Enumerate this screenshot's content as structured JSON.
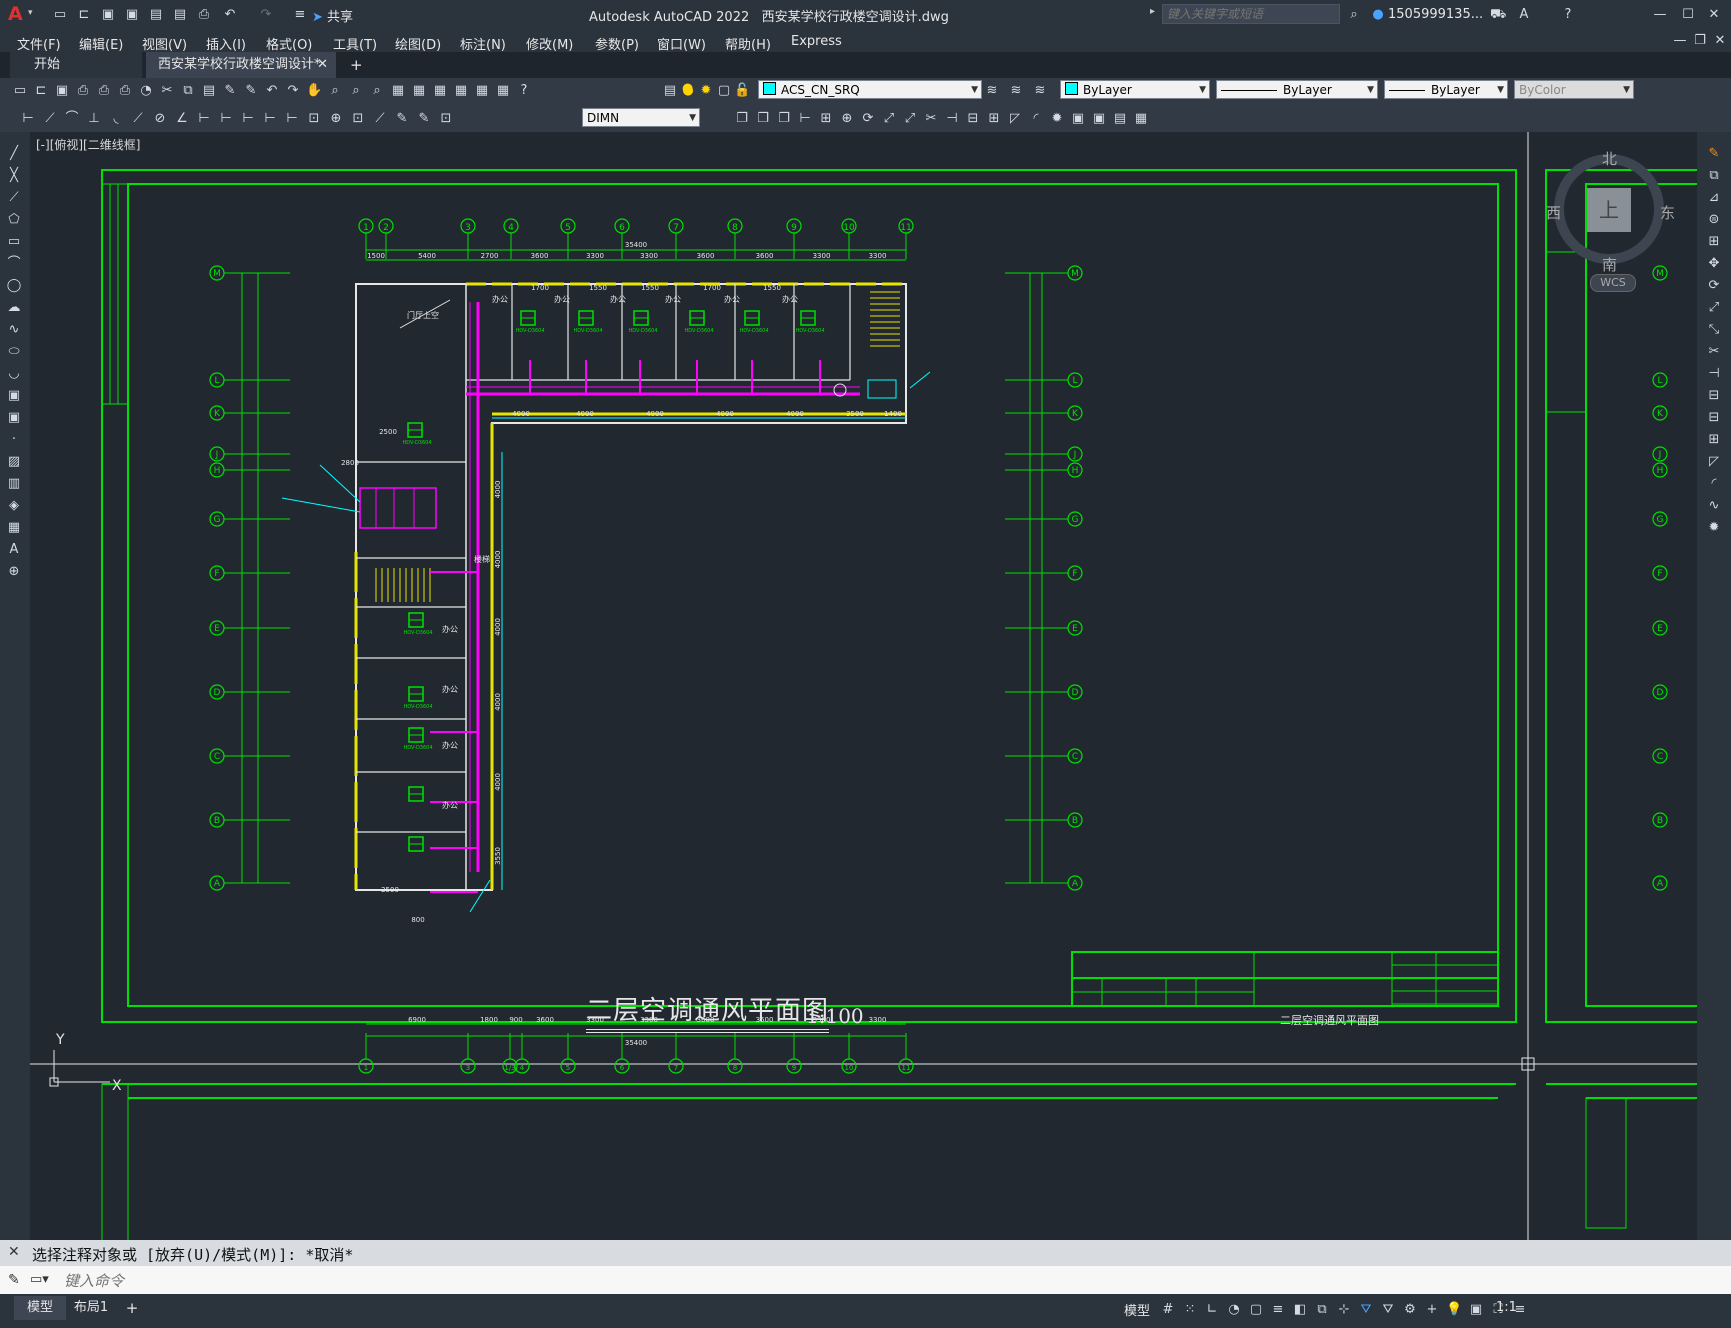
{
  "app": {
    "title": "Autodesk AutoCAD 2022",
    "filename": "西安某学校行政楼空调设计.dwg",
    "search_placeholder": "键入关键字或短语",
    "user": "1505999135...",
    "share_label": "共享"
  },
  "menu": [
    "文件(F)",
    "编辑(E)",
    "视图(V)",
    "插入(I)",
    "格式(O)",
    "工具(T)",
    "绘图(D)",
    "标注(N)",
    "修改(M)",
    "参数(P)",
    "窗口(W)",
    "帮助(H)",
    "Express"
  ],
  "tabs": {
    "start": "开始",
    "active": "西安某学校行政楼空调设计*",
    "add": "+"
  },
  "toolbar": {
    "layer": "ACS_CN_SRQ",
    "color": "ByLayer",
    "linetype": "ByLayer",
    "lineweight": "ByLayer",
    "plotstyle": "ByColor",
    "dimstyle": "DIMN"
  },
  "viewport_label": "[-][俯视][二维线框]",
  "viewcube": {
    "north": "北",
    "south": "南",
    "east": "东",
    "west": "西",
    "top": "上",
    "wcs": "WCS"
  },
  "drawing": {
    "title": "二层空调通风平面图",
    "scale": "1:100",
    "titleblock_name": "二层空调通风平面图",
    "top_grid": [
      "1",
      "2",
      "3",
      "4",
      "5",
      "6",
      "7",
      "8",
      "9",
      "10",
      "11"
    ],
    "bottom_grid": [
      "1",
      "3",
      "1/3",
      "4",
      "5",
      "6",
      "7",
      "8",
      "9",
      "10",
      "11"
    ],
    "row_grid": [
      "M",
      "L",
      "K",
      "J",
      "H",
      "G",
      "F",
      "E",
      "D",
      "C",
      "B",
      "A"
    ],
    "top_dims": [
      "1500",
      "5400",
      "2700",
      "3600",
      "3300",
      "3300",
      "3600",
      "3600",
      "3300",
      "3300"
    ],
    "top_total": "35400",
    "bottom_dims": [
      "6900",
      "1800",
      "900",
      "3600",
      "3300",
      "3300",
      "3600",
      "3600",
      "3300",
      "3300"
    ],
    "bottom_total": "35400",
    "corridor_dims": [
      "4000",
      "4000",
      "4000",
      "4000",
      "4000",
      "3500",
      "1400"
    ],
    "vertical_dims": [
      "4000",
      "4000",
      "4000",
      "4000",
      "4000",
      "3550"
    ],
    "room_labels": [
      "门厅上空",
      "办公",
      "办公",
      "办公",
      "办公",
      "办公",
      "办公",
      "楼梯",
      "办公",
      "办公",
      "办公",
      "办公"
    ],
    "unit_tags": [
      "HDV-D3604",
      "HDV-D3604",
      "HDV-D3604",
      "HDV-D3604",
      "HDV-D3604",
      "HDV-D3604",
      "HDV-D3604",
      "HDV-D3604",
      "HDV-D3604",
      "HDV-D3604"
    ],
    "small_dims": [
      "1700",
      "1550",
      "1550",
      "1700",
      "1550",
      "2800",
      "2500",
      "2500",
      "800"
    ]
  },
  "command": {
    "history": "选择注释对象或 [放弃(U)/模式(M)]: *取消*",
    "placeholder": "键入命令"
  },
  "status": {
    "model": "模型",
    "layout1": "布局1",
    "add": "+",
    "scale": "1:1"
  },
  "colors": {
    "green": "#00e000",
    "cyan": "#00ffff",
    "magenta": "#ff00ff",
    "yellow": "#e6e600",
    "white": "#e6e6e6",
    "canvas": "#212830"
  }
}
